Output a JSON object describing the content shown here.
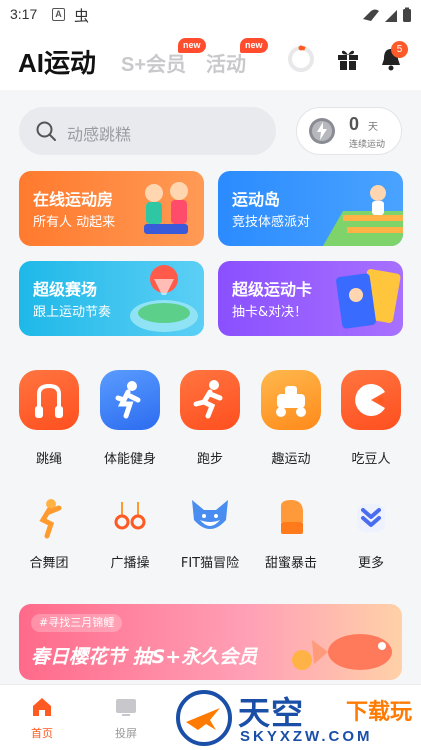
{
  "status_bar": {
    "time": "3:17",
    "a_icon": "A",
    "app_icon_glyph": "虫"
  },
  "header": {
    "tabs": [
      {
        "label": "AI运动",
        "active": true
      },
      {
        "label": "S+会员",
        "badge": "new"
      },
      {
        "label": "活动",
        "badge": "new"
      }
    ],
    "notification_count": "5",
    "icons": [
      "ring-progress-icon",
      "gift-icon",
      "bell-icon"
    ]
  },
  "search": {
    "placeholder": "动感跳糕"
  },
  "streak": {
    "count": "0",
    "unit": "天",
    "label": "连续运动"
  },
  "cards": [
    {
      "title": "在线运动房",
      "subtitle": "所有人 动起来"
    },
    {
      "title": "运动岛",
      "subtitle": "竞技体感派对"
    },
    {
      "title": "超级赛场",
      "subtitle": "跟上运动节奏"
    },
    {
      "title": "超级运动卡",
      "subtitle": "抽卡&对决！"
    }
  ],
  "main_grid": [
    {
      "label": "跳绳",
      "icon": "jump-rope-icon"
    },
    {
      "label": "体能健身",
      "icon": "fitness-icon"
    },
    {
      "label": "跑步",
      "icon": "running-icon"
    },
    {
      "label": "趣运动",
      "icon": "fun-sport-icon"
    },
    {
      "label": "吃豆人",
      "icon": "pacman-icon"
    }
  ],
  "secondary_grid": [
    {
      "label": "合舞团",
      "icon": "dance-icon"
    },
    {
      "label": "广播操",
      "icon": "rings-icon"
    },
    {
      "label": "FIT猫冒险",
      "icon": "fox-icon"
    },
    {
      "label": "甜蜜暴击",
      "icon": "boxing-glove-icon"
    },
    {
      "label": "更多",
      "icon": "more-chevron-icon"
    }
  ],
  "promo": {
    "tag": "#寻找三月锦鲤",
    "title": "春日樱花节  抽S+永久会员"
  },
  "bottom_nav": [
    {
      "label": "首页",
      "active": true
    },
    {
      "label": "投屏"
    }
  ],
  "watermark": {
    "text": "天空",
    "text2": "下载玩",
    "url": "SKYXZW.COM"
  },
  "colors": {
    "accent": "#ff5a22",
    "blue": "#2c6cf0",
    "purple": "#8a50ff"
  }
}
